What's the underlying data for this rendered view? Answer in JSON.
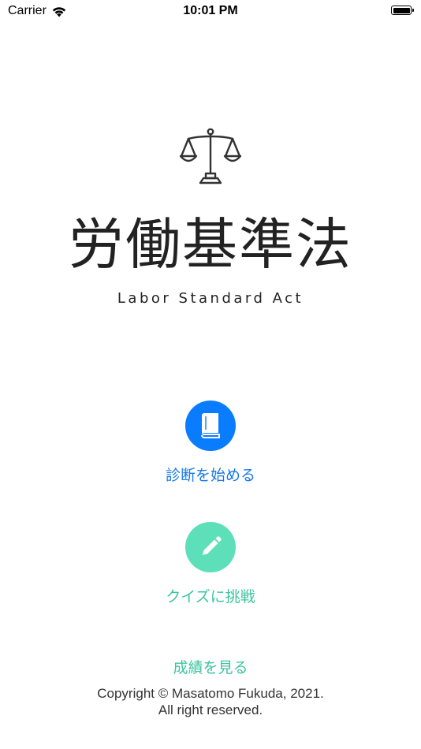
{
  "status_bar": {
    "carrier": "Carrier",
    "time": "10:01 PM",
    "icons": [
      "wifi-icon",
      "battery-icon"
    ]
  },
  "logo": {
    "icon": "scale-icon",
    "title_ja": "労働基準法",
    "title_en": "Labor Standard Act"
  },
  "actions": {
    "diagnose": {
      "icon": "book-icon",
      "label": "診断を始める",
      "color": "#0a7cff"
    },
    "quiz": {
      "icon": "pencil-icon",
      "label": "クイズに挑戦",
      "color": "#5ddfb9"
    },
    "results": {
      "label": "成績を見る"
    }
  },
  "footer": {
    "copyright_line1": "Copyright © Masatomo Fukuda, 2021.",
    "copyright_line2": "All right reserved."
  }
}
